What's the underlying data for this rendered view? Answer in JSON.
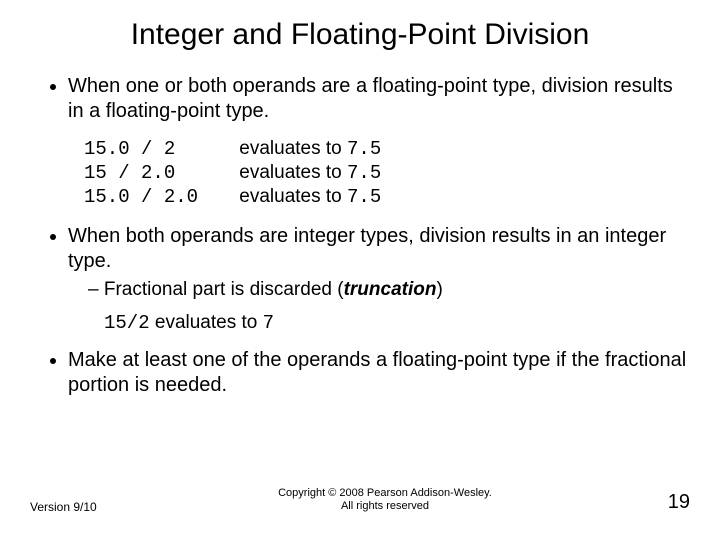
{
  "title": "Integer and Floating-Point Division",
  "bullets": {
    "b1": "When one or both operands are a floating-point type, division results in a floating-point type.",
    "b2": "When both operands are integer types, division results in an integer type.",
    "b2_sub": "Fractional part is discarded (",
    "b2_sub_em": "truncation",
    "b2_sub_close": ")",
    "b3": "Make at least one of the operands a floating-point type if the fractional portion is needed."
  },
  "examples": [
    {
      "expr": "15.0 / 2",
      "text": "evaluates to ",
      "result": "7.5"
    },
    {
      "expr": "15 / 2.0",
      "text": "evaluates to ",
      "result": "7.5"
    },
    {
      "expr": "15.0 / 2.0",
      "text": "evaluates to ",
      "result": "7.5"
    }
  ],
  "inline_example": {
    "expr": "15/2",
    "text": " evaluates to ",
    "result": "7"
  },
  "footer": {
    "version": "Version 9/10",
    "copyright_line1": "Copyright © 2008 Pearson Addison-Wesley.",
    "copyright_line2": "All rights reserved",
    "page": "19"
  }
}
